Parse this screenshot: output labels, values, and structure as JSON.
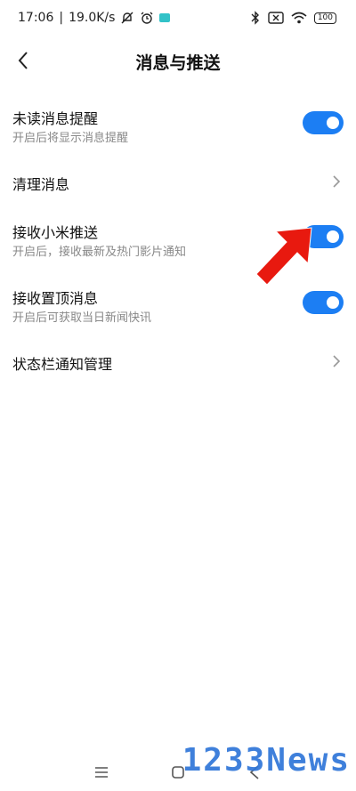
{
  "status_bar": {
    "time": "17:06",
    "speed": "19.0K/s",
    "battery": "100"
  },
  "header": {
    "title": "消息与推送"
  },
  "settings": [
    {
      "title": "未读消息提醒",
      "subtitle": "开启后将显示消息提醒",
      "control": "toggle",
      "on": true
    },
    {
      "title": "清理消息",
      "control": "chevron"
    },
    {
      "title": "接收小米推送",
      "subtitle": "开启后，接收最新及热门影片通知",
      "control": "toggle",
      "on": true
    },
    {
      "title": "接收置顶消息",
      "subtitle": "开启后可获取当日新闻快讯",
      "control": "toggle",
      "on": true
    },
    {
      "title": "状态栏通知管理",
      "control": "chevron"
    }
  ],
  "colors": {
    "toggle_on": "#1c7ef3",
    "arrow": "#e8190f",
    "watermark": "#2f76d8"
  },
  "icons": {
    "back": "chevron-left-icon",
    "menu": "menu-icon",
    "home": "home-icon",
    "nav_back": "back-icon"
  },
  "watermark": "1233News"
}
